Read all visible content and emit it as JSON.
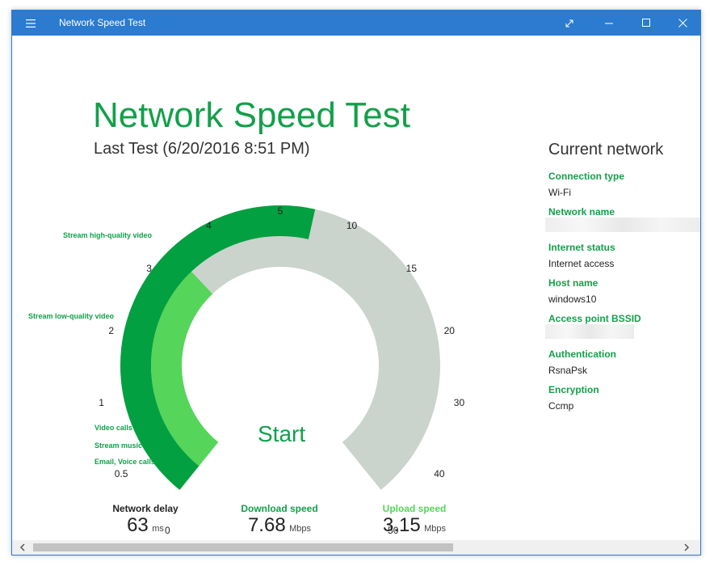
{
  "window": {
    "title": "Network Speed Test"
  },
  "header": {
    "title": "Network Speed Test",
    "last_test": "Last Test (6/20/2016 8:51 PM)"
  },
  "gauge": {
    "ticks": [
      "0",
      "0.5",
      "1",
      "2",
      "3",
      "4",
      "5",
      "10",
      "15",
      "20",
      "30",
      "40",
      "50"
    ],
    "usage_labels": [
      "Stream high-quality video",
      "Stream low-quality video",
      "Video calls",
      "Stream music",
      "Email, Voice calls"
    ],
    "start_label": "Start",
    "download_mbps": 7.68,
    "upload_mbps": 3.15,
    "colors": {
      "download": "#02a040",
      "upload": "#55d55a",
      "track": "#cbd3cd"
    }
  },
  "stats": {
    "delay": {
      "label": "Network delay",
      "value": "63",
      "unit": "ms"
    },
    "download": {
      "label": "Download speed",
      "value": "7.68",
      "unit": "Mbps"
    },
    "upload": {
      "label": "Upload speed",
      "value": "3.15",
      "unit": "Mbps"
    }
  },
  "network": {
    "title": "Current network",
    "connection_type_label": "Connection type",
    "connection_type": "Wi-Fi",
    "network_name_label": "Network name",
    "internet_status_label": "Internet status",
    "internet_status": "Internet access",
    "host_name_label": "Host name",
    "host_name": "windows10",
    "bssid_label": "Access point BSSID",
    "authentication_label": "Authentication",
    "authentication": "RsnaPsk",
    "encryption_label": "Encryption",
    "encryption": "Ccmp"
  },
  "colors": {
    "accent": "#12a04a",
    "titlebar": "#2b7bd0",
    "upload_label": "#55d55a"
  },
  "icons": {
    "menu": "hamburger-icon",
    "expand": "expand-icon",
    "minimize": "minimize-icon",
    "maximize": "maximize-icon",
    "close": "close-icon"
  }
}
